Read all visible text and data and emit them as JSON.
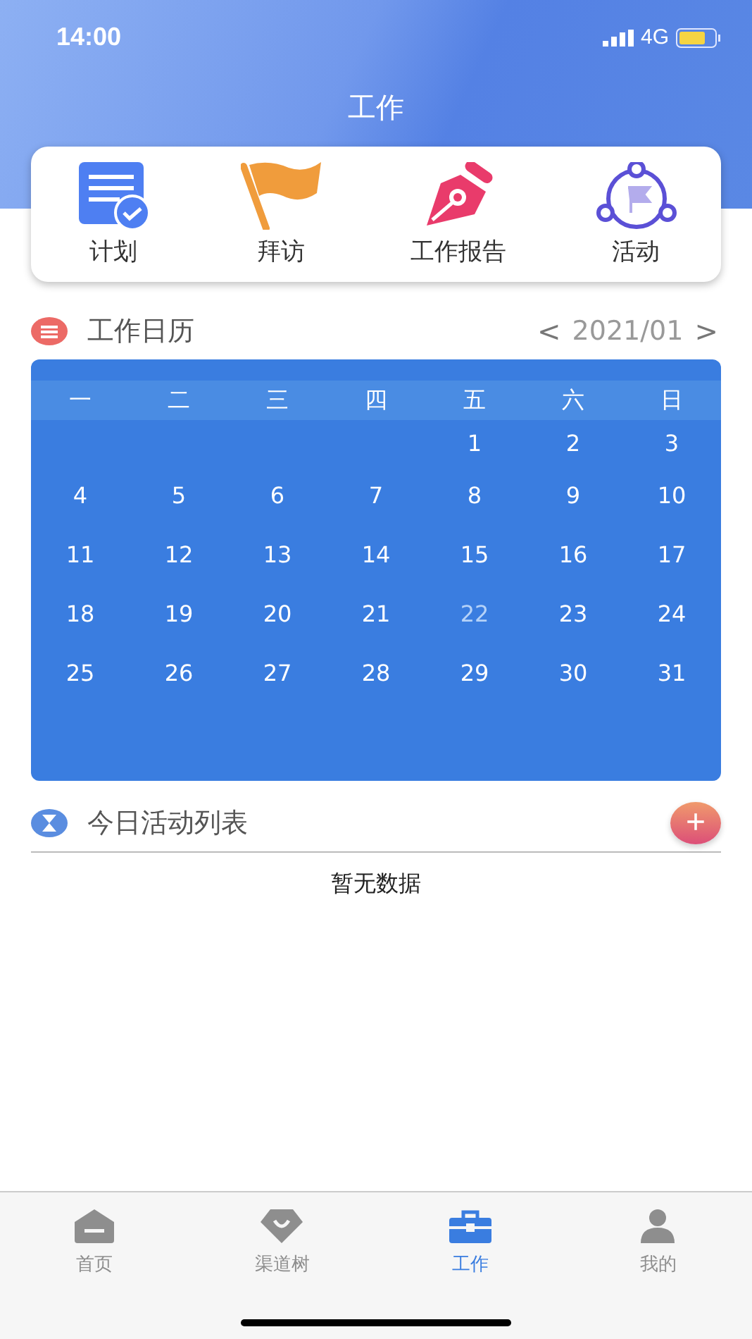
{
  "status_bar": {
    "time": "14:00",
    "network": "4G"
  },
  "header": {
    "title": "工作"
  },
  "shortcuts": [
    {
      "label": "计划",
      "kind": "plan"
    },
    {
      "label": "拜访",
      "kind": "flag"
    },
    {
      "label": "工作报告",
      "kind": "pen"
    },
    {
      "label": "活动",
      "kind": "share"
    }
  ],
  "calendar": {
    "title": "工作日历",
    "prev": "<",
    "month": "2021/01",
    "next": ">",
    "weekdays": [
      "一",
      "二",
      "三",
      "四",
      "五",
      "六",
      "日"
    ],
    "weeks": [
      {
        "kind": "partial",
        "days": [
          {
            "label": "1",
            "selected": false
          },
          {
            "label": "2",
            "selected": false
          },
          {
            "label": "3",
            "selected": false
          }
        ]
      },
      {
        "kind": "full",
        "days": [
          {
            "label": "4",
            "selected": false
          },
          {
            "label": "5",
            "selected": false
          },
          {
            "label": "6",
            "selected": false
          },
          {
            "label": "7",
            "selected": false
          },
          {
            "label": "8",
            "selected": false
          },
          {
            "label": "9",
            "selected": false
          },
          {
            "label": "10",
            "selected": false
          }
        ]
      },
      {
        "kind": "full",
        "days": [
          {
            "label": "11",
            "selected": false
          },
          {
            "label": "12",
            "selected": false
          },
          {
            "label": "13",
            "selected": false
          },
          {
            "label": "14",
            "selected": false
          },
          {
            "label": "15",
            "selected": false
          },
          {
            "label": "16",
            "selected": false
          },
          {
            "label": "17",
            "selected": false
          }
        ]
      },
      {
        "kind": "full",
        "days": [
          {
            "label": "18",
            "selected": false
          },
          {
            "label": "19",
            "selected": false
          },
          {
            "label": "20",
            "selected": false
          },
          {
            "label": "21",
            "selected": false
          },
          {
            "label": "22",
            "selected": true
          },
          {
            "label": "23",
            "selected": false
          },
          {
            "label": "24",
            "selected": false
          }
        ]
      },
      {
        "kind": "full",
        "days": [
          {
            "label": "25",
            "selected": false
          },
          {
            "label": "26",
            "selected": false
          },
          {
            "label": "27",
            "selected": false
          },
          {
            "label": "28",
            "selected": false
          },
          {
            "label": "29",
            "selected": false
          },
          {
            "label": "30",
            "selected": false
          },
          {
            "label": "31",
            "selected": false
          }
        ]
      }
    ]
  },
  "activities": {
    "title": "今日活动列表",
    "add": "+",
    "empty": "暂无数据"
  },
  "tab_bar": [
    {
      "label": "首页",
      "kind": "home",
      "selected": false
    },
    {
      "label": "渠道树",
      "kind": "gem",
      "selected": false
    },
    {
      "label": "工作",
      "kind": "toolbox",
      "selected": true
    },
    {
      "label": "我的",
      "kind": "person",
      "selected": false
    }
  ]
}
